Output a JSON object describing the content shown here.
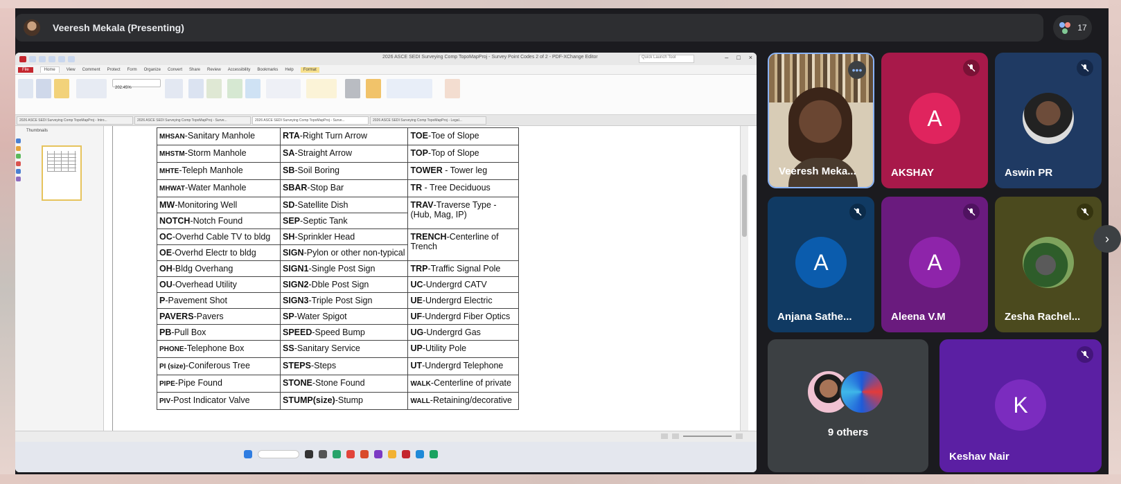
{
  "presenter_bar": {
    "name": "Veeresh Mekala (Presenting)"
  },
  "participant_count": "17",
  "shared_app": {
    "window_title": "2026 ASCE SEDI Surveying Comp TopoMapProj - Survey Point Codes 2 of 2 - PDF-XChange Editor",
    "ribbon_tabs": [
      "File",
      "Home",
      "View",
      "Comment",
      "Protect",
      "Form",
      "Organize",
      "Convert",
      "Share",
      "Review",
      "Accessibility",
      "Bookmarks",
      "Help",
      "Format"
    ],
    "document_tabs": [
      "2026 ASCE SEDI Surveying Comp TopoMapProj - Intro...",
      "2026 ASCE SEDI Surveying Comp TopoMapProj - Surve...",
      "2026 ASCE SEDI Surveying Comp TopoMapProj - Surve...",
      "2026 ASCE SEDI Surveying Comp TopoMapProj - Legal..."
    ],
    "thumbnails_title": "Thumbnails",
    "zoom": "202.45%"
  },
  "codes_table": [
    {
      "c1": {
        "code": "MHSAN",
        "desc": "-Sanitary Manhole"
      },
      "c2": {
        "code": "RTA",
        "desc": "-Right Turn Arrow"
      },
      "c3": {
        "code": "TOE",
        "desc": "-Toe of Slope"
      }
    },
    {
      "c1": {
        "code": "MHSTM",
        "desc": "-Storm Manhole"
      },
      "c2": {
        "code": "SA",
        "desc": "-Straight Arrow"
      },
      "c3": {
        "code": "TOP",
        "desc": "-Top of Slope"
      }
    },
    {
      "c1": {
        "code": "MHTE",
        "desc": "-Teleph Manhole"
      },
      "c2": {
        "code": "SB",
        "desc": "-Soil Boring"
      },
      "c3": {
        "code": "TOWER",
        "desc": " - Tower leg"
      }
    },
    {
      "c1": {
        "code": "MHWAT",
        "desc": "-Water Manhole"
      },
      "c2": {
        "code": "SBAR",
        "desc": "-Stop Bar"
      },
      "c3": {
        "code": "TR",
        "desc": " - Tree Deciduous"
      }
    },
    {
      "c1": {
        "code": "MW",
        "desc": "-Monitoring Well"
      },
      "c2": {
        "code": "SD",
        "desc": "-Satellite Dish"
      },
      "c3": {
        "code": "TRAV",
        "desc": "-Traverse Type - (Hub, Mag, IP)"
      }
    },
    {
      "c1": {
        "code": "NOTCH",
        "desc": "-Notch Found"
      },
      "c2": {
        "code": "SEP",
        "desc": "-Septic Tank"
      },
      "c3": {
        "code": "",
        "desc": ""
      }
    },
    {
      "c1": {
        "code": "OC",
        "desc": "-Overhd Cable TV to bldg"
      },
      "c2": {
        "code": "SH",
        "desc": "-Sprinkler Head"
      },
      "c3": {
        "code": "TRENCH",
        "desc": "-Centerline of Trench"
      }
    },
    {
      "c1": {
        "code": "OE",
        "desc": "-Overhd Electr to bldg"
      },
      "c2": {
        "code": "SIGN",
        "desc": "-Pylon or other non-typical"
      },
      "c3": {
        "code": "",
        "desc": ""
      }
    },
    {
      "c1": {
        "code": "OH",
        "desc": "-Bldg Overhang"
      },
      "c2": {
        "code": "SIGN1",
        "desc": "-Single Post Sign"
      },
      "c3": {
        "code": "TRP",
        "desc": "-Traffic Signal Pole"
      }
    },
    {
      "c1": {
        "code": "OU",
        "desc": "-Overhead Utility"
      },
      "c2": {
        "code": "SIGN2",
        "desc": "-Dble Post Sign"
      },
      "c3": {
        "code": "UC",
        "desc": "-Undergrd CATV"
      }
    },
    {
      "c1": {
        "code": "P",
        "desc": "-Pavement Shot"
      },
      "c2": {
        "code": "SIGN3",
        "desc": "-Triple Post Sign"
      },
      "c3": {
        "code": "UE",
        "desc": "-Undergrd Electric"
      }
    },
    {
      "c1": {
        "code": "PAVERS",
        "desc": "-Pavers"
      },
      "c2": {
        "code": "SP",
        "desc": "-Water Spigot"
      },
      "c3": {
        "code": "UF",
        "desc": "-Undergrd Fiber Optics"
      }
    },
    {
      "c1": {
        "code": "PB",
        "desc": "-Pull Box"
      },
      "c2": {
        "code": "SPEED",
        "desc": "-Speed Bump"
      },
      "c3": {
        "code": "UG",
        "desc": "-Undergrd Gas"
      }
    },
    {
      "c1": {
        "code": "PHONE",
        "desc": "-Telephone Box"
      },
      "c2": {
        "code": "SS",
        "desc": "-Sanitary Service"
      },
      "c3": {
        "code": "UP",
        "desc": "-Utility Pole"
      }
    },
    {
      "c1": {
        "code": "PI (size)",
        "desc": "-Coniferous Tree"
      },
      "c2": {
        "code": "STEPS",
        "desc": "-Steps"
      },
      "c3": {
        "code": "UT",
        "desc": "-Undergrd Telephone"
      }
    },
    {
      "c1": {
        "code": "PIPE",
        "desc": "-Pipe Found"
      },
      "c2": {
        "code": "STONE",
        "desc": "-Stone Found"
      },
      "c3": {
        "code": "WALK",
        "desc": "-Centerline of private"
      }
    },
    {
      "c1": {
        "code": "PIV",
        "desc": "-Post Indicator Valve"
      },
      "c2": {
        "code": "STUMP(size)",
        "desc": "-Stump"
      },
      "c3": {
        "code": "WALL",
        "desc": "-Retaining/decorative"
      }
    }
  ],
  "participants": {
    "veeresh": {
      "name": "Veeresh Meka..."
    },
    "akshay": {
      "name": "AKSHAY",
      "initial": "A"
    },
    "aswin": {
      "name": "Aswin PR"
    },
    "anjana": {
      "name": "Anjana Sathe...",
      "initial": "A"
    },
    "aleena": {
      "name": "Aleena V.M",
      "initial": "A"
    },
    "zesha": {
      "name": "Zesha Rachel..."
    },
    "others": {
      "label": "9 others"
    },
    "keshav": {
      "name": "Keshav Nair",
      "initial": "K"
    }
  },
  "colors": {
    "akshay_tile": "#a8194a",
    "akshay_avatar": "#e0245e",
    "aswin_tile": "#1f3a63",
    "anjana_tile": "#103a63",
    "anjana_avatar": "#0b5cad",
    "aleena_tile": "#6a1b7e",
    "aleena_avatar": "#8e24aa",
    "zesha_tile": "#4b4a1e",
    "others_tile": "#3c4043",
    "keshav_tile": "#5b1fa3",
    "keshav_avatar": "#7b2cbf"
  },
  "icons": {
    "mic_off": "mic-off-icon",
    "more": "more-options-icon",
    "next": "chevron-right-icon"
  }
}
